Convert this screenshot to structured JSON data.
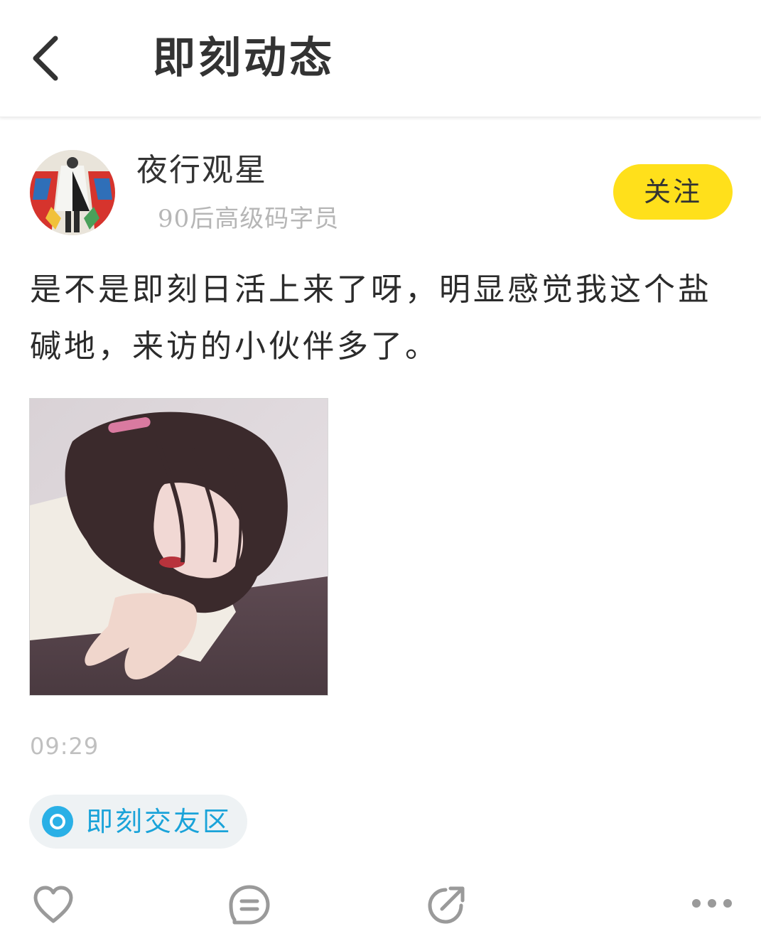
{
  "header": {
    "title": "即刻动态",
    "back_icon": "chevron-left-icon"
  },
  "user": {
    "name": "夜行观星",
    "tagline": "90后高级码字员",
    "follow_label": "关注"
  },
  "post": {
    "text": "是不是即刻日活上来了呀，明显感觉我这个盐碱地，来访的小伙伴多了。",
    "time": "09:29",
    "topic": "即刻交友区"
  },
  "actions": {
    "like_icon": "heart-icon",
    "comment_icon": "comment-icon",
    "share_icon": "share-icon",
    "more_icon": "more-dots-icon"
  },
  "colors": {
    "accent_yellow": "#ffe01b",
    "topic_blue": "#1aa3d9",
    "muted_gray": "#b6b6b6"
  }
}
